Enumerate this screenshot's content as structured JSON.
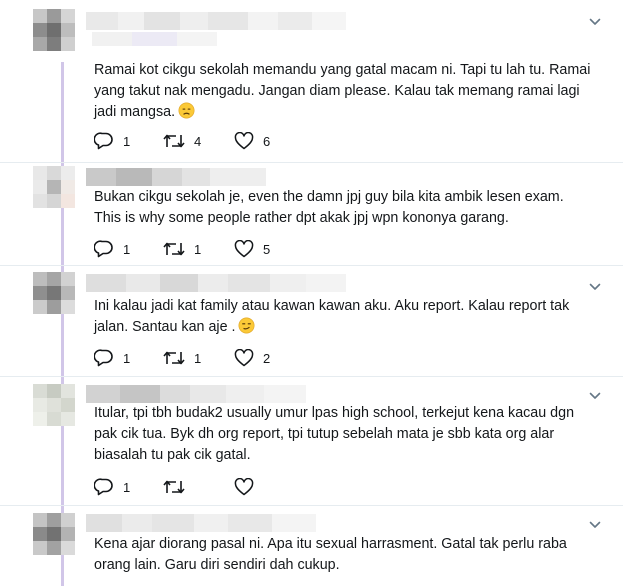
{
  "tweets": [
    {
      "text": "Ramai kot cikgu sekolah memandu yang gatal macam ni. Tapi tu lah tu. Ramai yang takut nak mengadu. Jangan diam please. Kalau tak memang ramai lagi jadi mangsa.",
      "emoji": "disappointed-face",
      "replies": "1",
      "retweets": "4",
      "likes": "6"
    },
    {
      "text": "Bukan cikgu sekolah je, even the damn jpj guy bila kita ambik lesen exam. This is why some people rather dpt akak jpj wpn kononya garang.",
      "replies": "1",
      "retweets": "1",
      "likes": "5"
    },
    {
      "text": "Ini kalau jadi kat family atau kawan kawan aku. Aku report. Kalau report tak jalan. Santau kan aje .",
      "emoji": "smirk-face",
      "replies": "1",
      "retweets": "1",
      "likes": "2"
    },
    {
      "text": "Itular, tpi tbh budak2 usually umur lpas high school, terkejut kena kacau dgn pak cik tua. Byk dh org report, tpi tutup sebelah mata je sbb kata org alar biasalah tu pak cik gatal.",
      "replies": "1",
      "retweets": "",
      "likes": ""
    },
    {
      "text": "Kena ajar diorang pasal ni. Apa itu sexual harrasment. Gatal tak perlu raba orang lain. Garu diri sendiri dah cukup.",
      "replies": "",
      "retweets": "",
      "likes": ""
    }
  ],
  "icons": {
    "reply": "reply-icon",
    "retweet": "retweet-icon",
    "like": "heart-icon",
    "more": "chevron-down-icon"
  },
  "colors": {
    "text": "#14171a",
    "icon": "#657786",
    "divider": "#e6ecf0",
    "thread_line": "#d1c6e8"
  }
}
